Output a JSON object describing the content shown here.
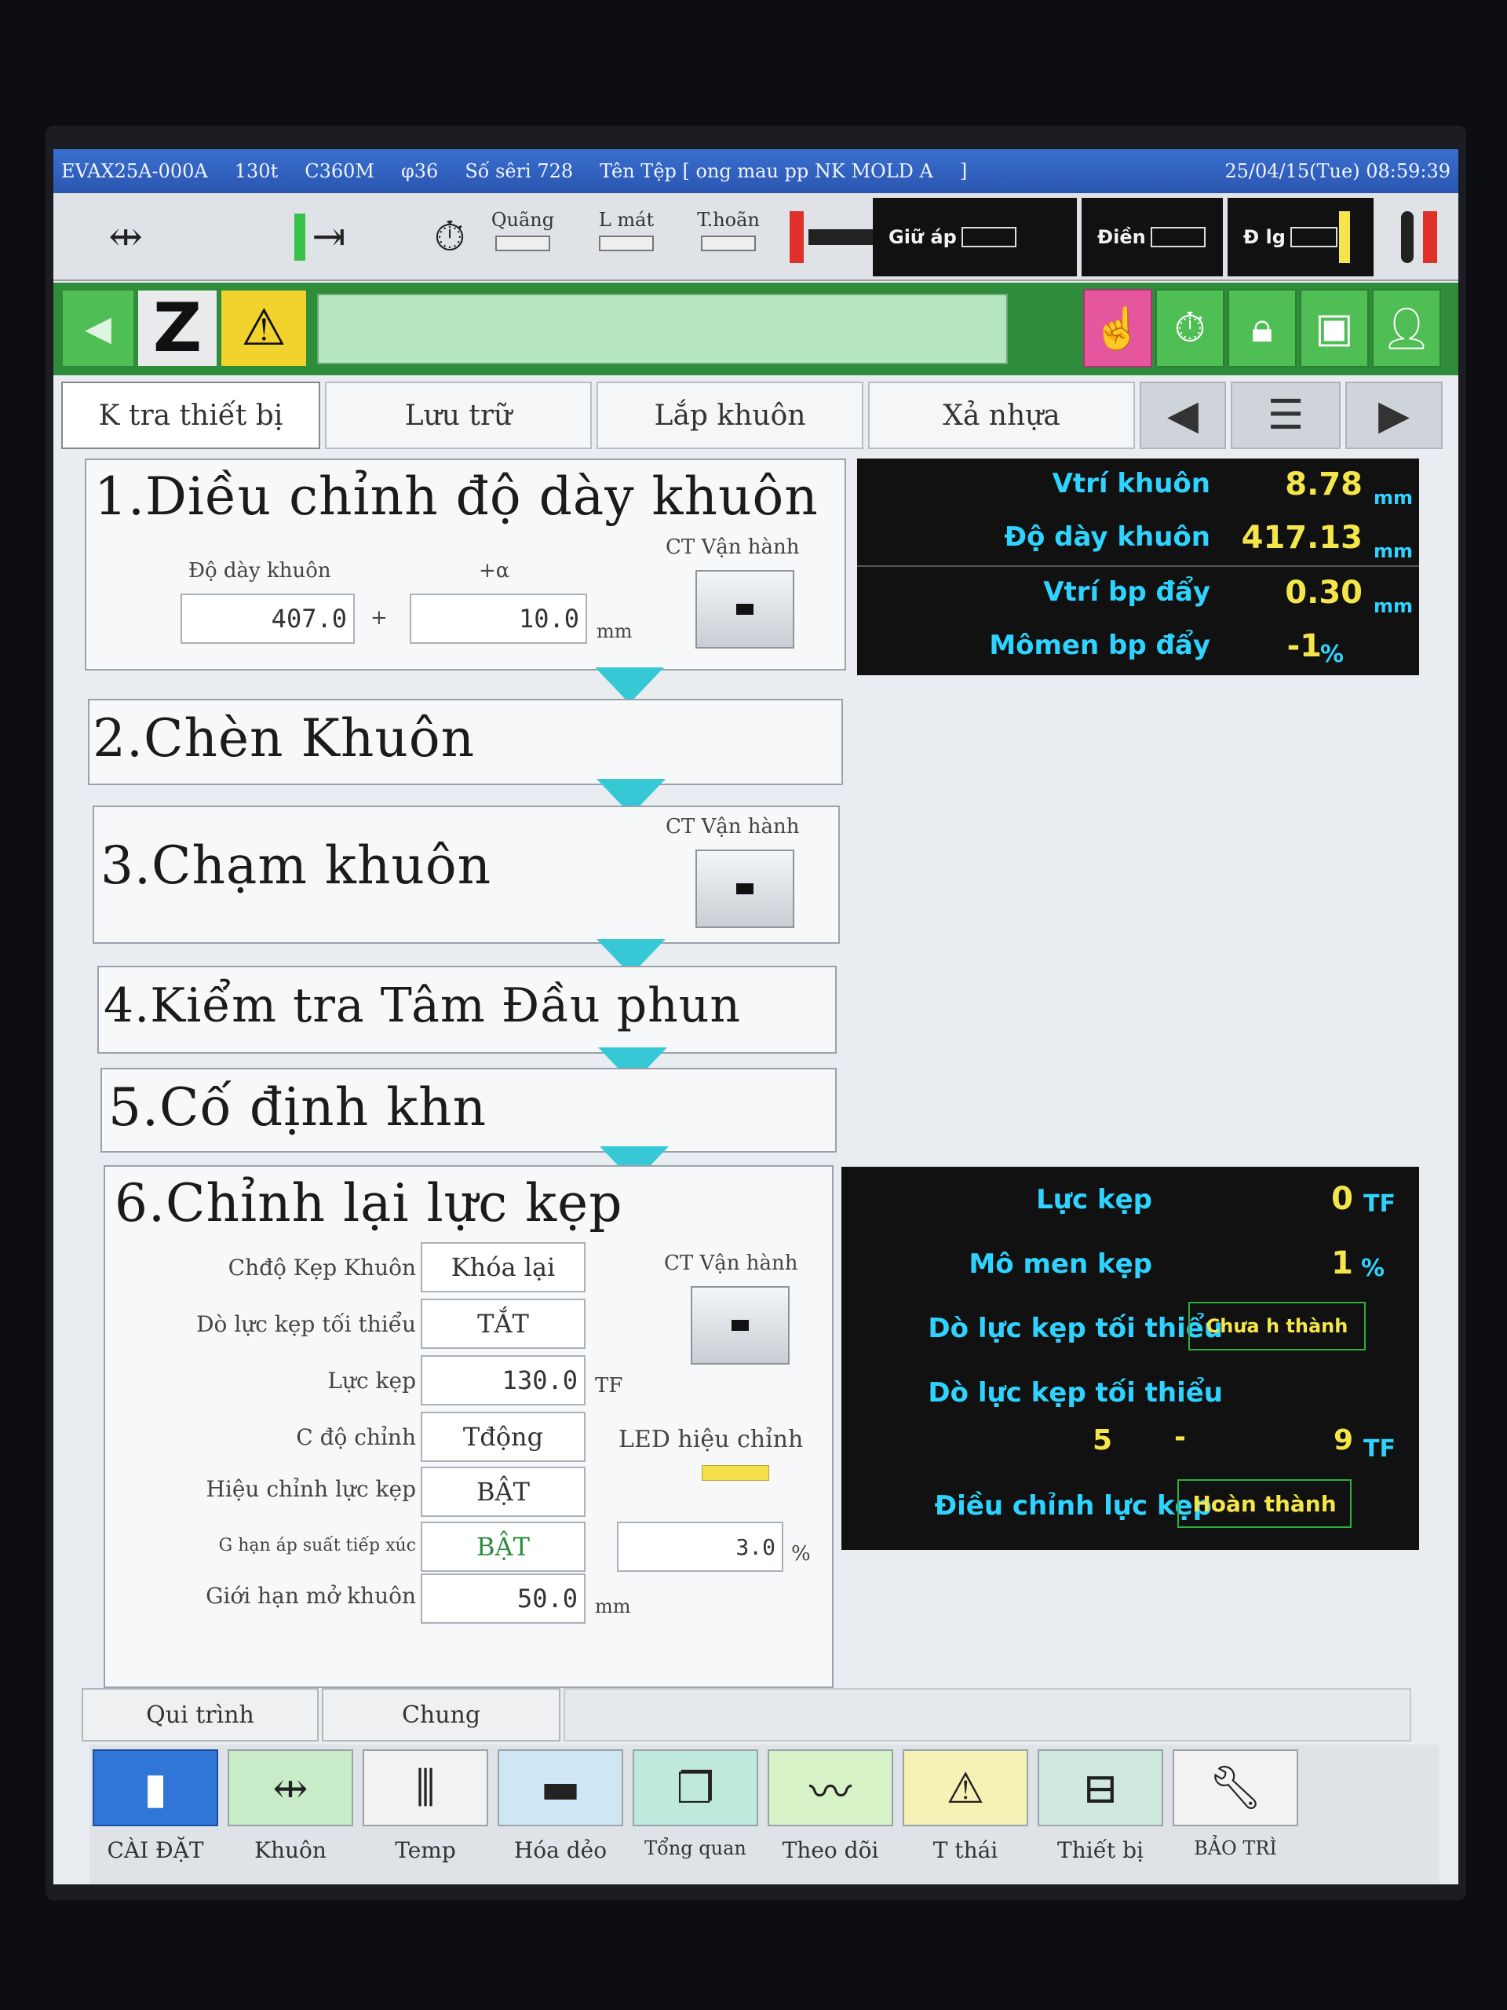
{
  "header": {
    "model": "EVAX25A-000A",
    "tonnage": "130t",
    "controller": "C360M",
    "screw": "φ36",
    "serial": "Số sêri 728",
    "file": "Tên Tệp [ ong mau pp NK MOLD A",
    "file_end": "]",
    "datetime": "25/04/15(Tue) 08:59:39"
  },
  "status": {
    "quang": "Quãng",
    "lmat": "L mát",
    "thoan": "T.hoãn",
    "giu_ap": "Giữ áp",
    "dien": "Điền",
    "dlg": "Đ lg"
  },
  "toolbar": {
    "back_icon": "◀",
    "z_label": "Z",
    "warn_icon": "⚠"
  },
  "tabs": [
    "K tra thiết bị",
    "Lưu trữ",
    "Lắp khuôn",
    "Xả nhựa"
  ],
  "steps": {
    "s1": {
      "title": "1.Diều chỉnh độ dày khuôn",
      "thickness_label": "Độ dày khuôn",
      "alpha_label": "+α",
      "thickness": "407.0",
      "plus": "+",
      "alpha": "10.0",
      "unit": "mm",
      "op_label": "CT Vận hành"
    },
    "s2": {
      "title": "2.Chèn Khuôn"
    },
    "s3": {
      "title": "3.Chạm khuôn",
      "op_label": "CT Vận hành"
    },
    "s4": {
      "title": "4.Kiểm tra Tâm Đầu phun"
    },
    "s5": {
      "title": "5.Cố định khn"
    },
    "s6": {
      "title": "6.Chỉnh lại lực kẹp",
      "op_label": "CT Vận hành",
      "rows": [
        {
          "label": "Chđộ Kẹp Khuôn",
          "value": "Khóa lại"
        },
        {
          "label": "Dò lực kẹp tối thiểu",
          "value": "TẮT"
        },
        {
          "label": "Lực kẹp",
          "value": "130.0",
          "unit": "TF"
        },
        {
          "label": "C độ chỉnh",
          "value": "Tđộng"
        },
        {
          "label": "Hiệu chỉnh lực kẹp",
          "value": "BẬT"
        },
        {
          "label": "G hạn áp suất tiếp xúc",
          "value": "BẬT"
        },
        {
          "label": "Giới hạn mở khuôn",
          "value": "50.0",
          "unit": "mm"
        }
      ],
      "led_label": "LED hiệu chỉnh",
      "contact_pct": "3.0",
      "pct_unit": "%"
    }
  },
  "monitor_top": [
    {
      "label": "Vtrí khuôn",
      "value": "8.78",
      "unit": "mm"
    },
    {
      "label": "Độ dày khuôn",
      "value": "417.13",
      "unit": "mm"
    },
    {
      "label": "Vtrí bp đẩy",
      "value": "0.30",
      "unit": "mm"
    },
    {
      "label": "Mômen bp đẩy",
      "value": "-1",
      "unit": "%"
    }
  ],
  "monitor_bottom": {
    "force_label": "Lực kẹp",
    "force": "0",
    "force_unit": "TF",
    "torque_label": "Mô men kẹp",
    "torque": "1",
    "torque_unit": "%",
    "min1_label": "Dò lực kẹp tối thiểu",
    "min1_status": "Chưa h thành",
    "min2_label": "Dò lực kẹp tối thiểu",
    "range_lo": "5",
    "range_sep": "-",
    "range_hi": "9",
    "range_unit": "TF",
    "adjust_label": "Điều chỉnh lực kẹp",
    "adjust_status": "Hoàn thành"
  },
  "subtabs": [
    "Qui trình",
    "Chung"
  ],
  "nav": [
    "CÀI ĐẶT",
    "Khuôn",
    "Temp",
    "Hóa dẻo",
    "Tổng quan",
    "Theo dõi",
    "T thái",
    "Thiết bị",
    "BẢO TRÌ"
  ],
  "colors": {
    "accent_green": "#2f8c3a",
    "value_yellow": "#f4e64a",
    "label_cyan": "#2fd3ff",
    "arrow_cyan": "#37c8d6"
  }
}
